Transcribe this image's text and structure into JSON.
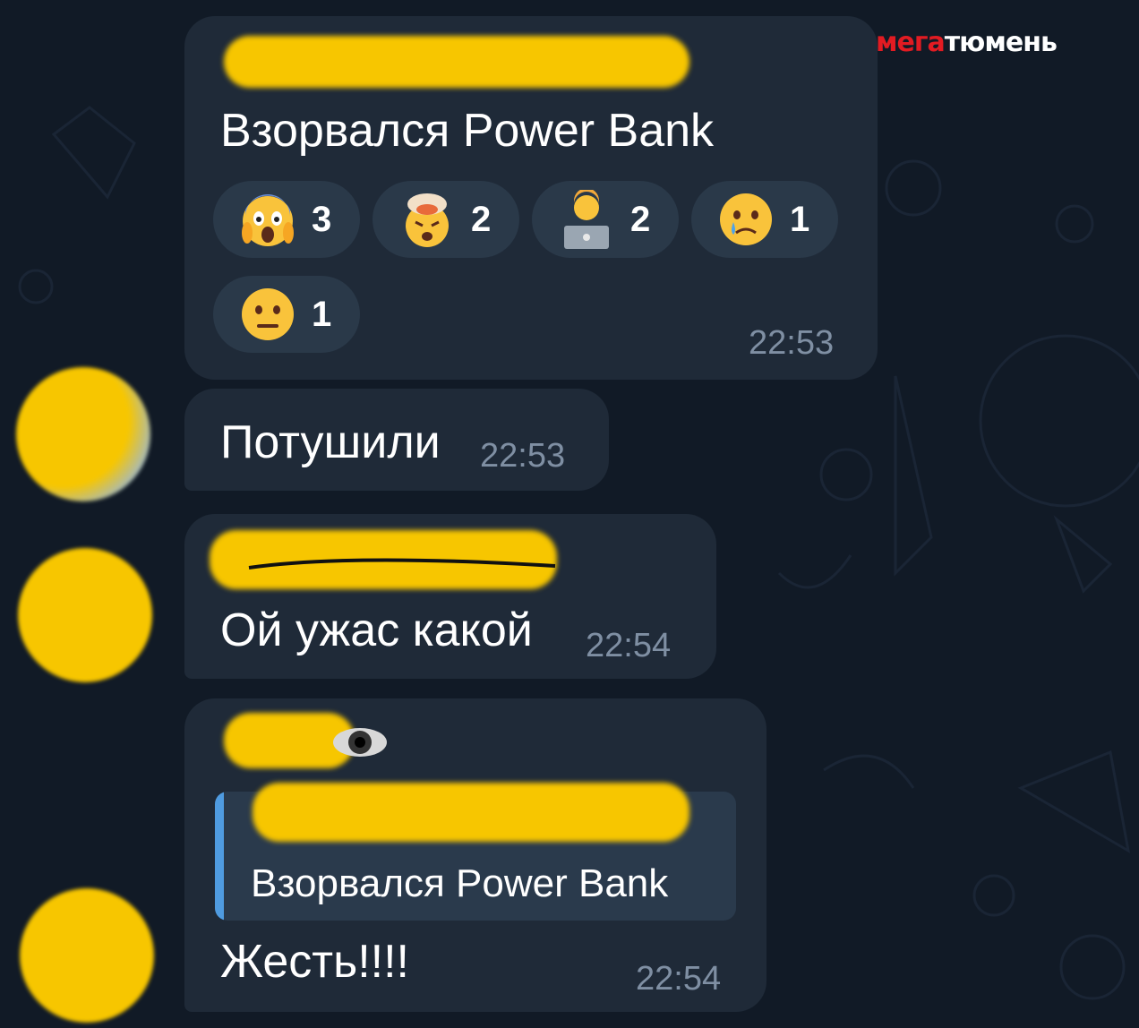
{
  "logo": {
    "part1": "мега",
    "part2": "тюмень"
  },
  "messages": [
    {
      "text": "Взорвался Power Bank",
      "time": "22:53",
      "reactions": [
        {
          "emoji": "face-screaming-in-fear",
          "count": "3"
        },
        {
          "emoji": "exploding-head",
          "count": "2"
        },
        {
          "emoji": "technologist",
          "count": "2"
        },
        {
          "emoji": "crying-face",
          "count": "1"
        },
        {
          "emoji": "neutral-face",
          "count": "1"
        }
      ]
    },
    {
      "text": "Потушили",
      "time": "22:53"
    },
    {
      "text": "Ой ужас какой",
      "time": "22:54"
    },
    {
      "reply_text": "Взорвался Power Bank",
      "text": "Жесть!!!!",
      "time": "22:54"
    }
  ],
  "colors": {
    "background": "#111a26",
    "bubble": "#1f2a38",
    "reaction": "#2a3949",
    "redaction": "#f7c600",
    "accent": "#4f9be0",
    "logo_red": "#e21b22"
  }
}
